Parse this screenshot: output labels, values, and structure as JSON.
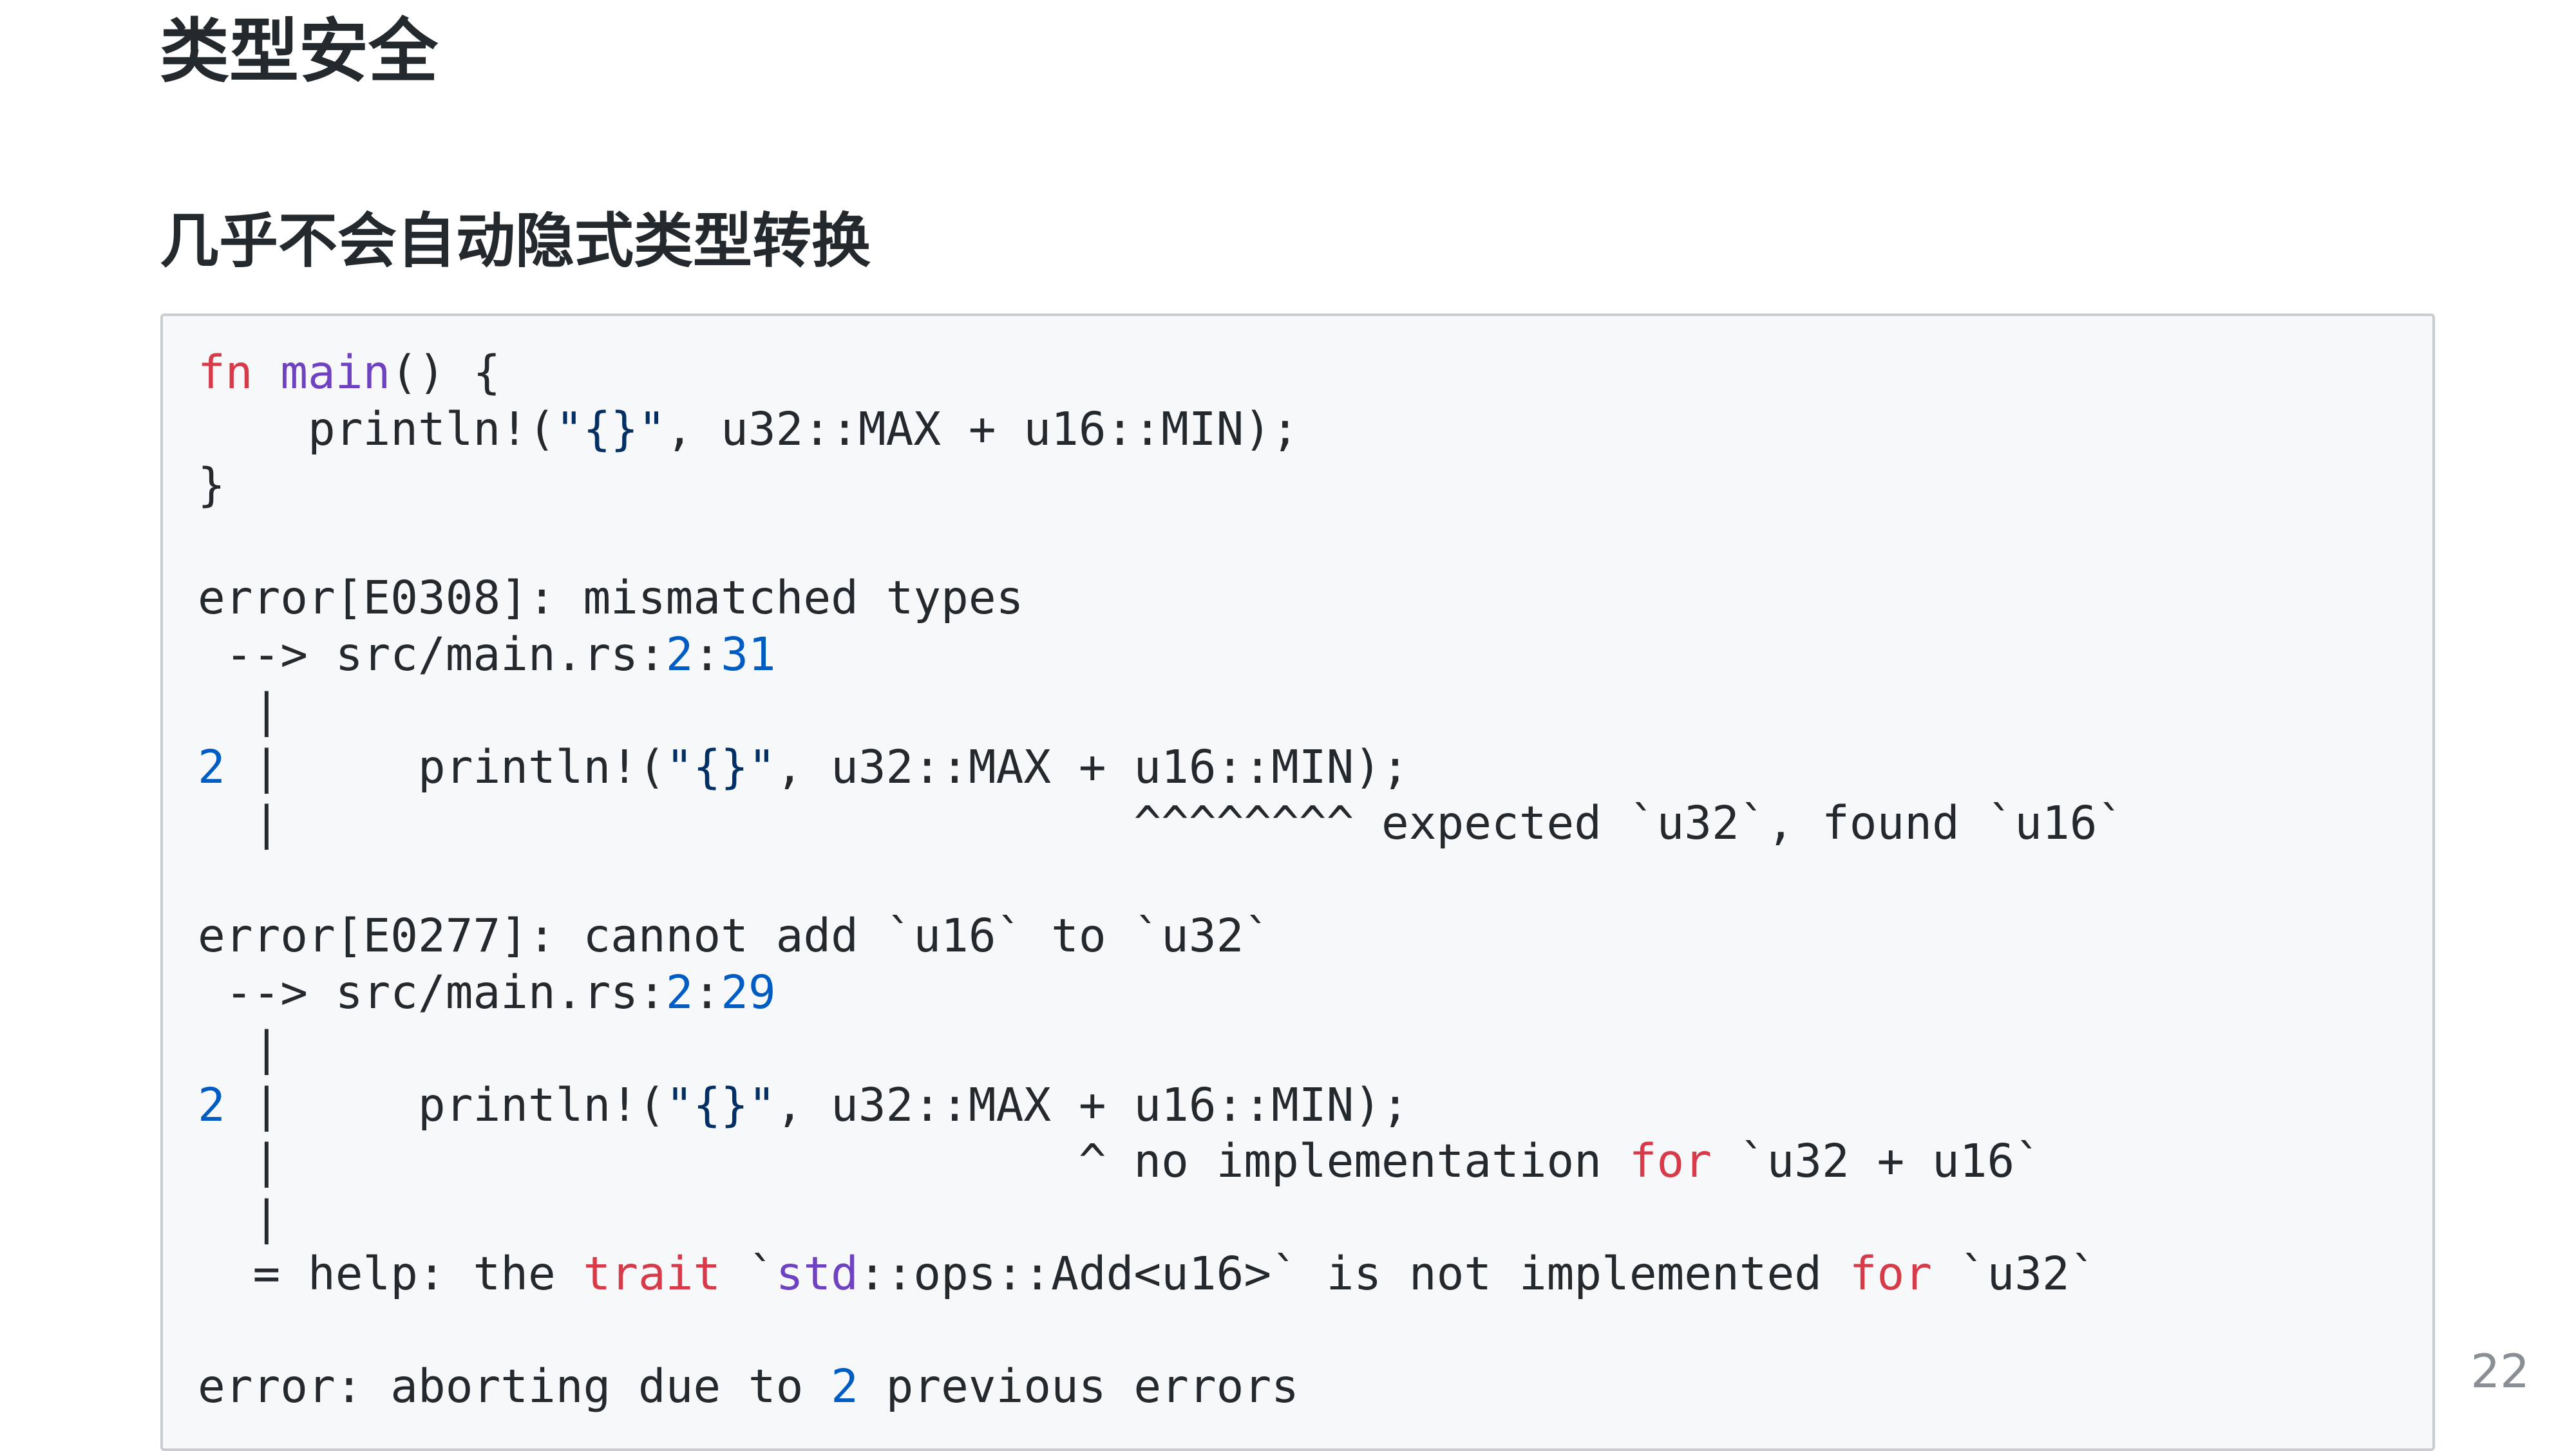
{
  "slide": {
    "title": "类型安全",
    "subtitle": "几乎不会自动隐式类型转换",
    "page_number": "22"
  },
  "code": {
    "lines": [
      [
        {
          "t": "fn",
          "c": "kw"
        },
        {
          "t": " "
        },
        {
          "t": "main",
          "c": "fn"
        },
        {
          "t": "() {"
        }
      ],
      [
        {
          "t": "    println!("
        },
        {
          "t": "\"{}\"",
          "c": "str"
        },
        {
          "t": ", u32::MAX + u16::MIN);"
        }
      ],
      [
        {
          "t": "}"
        }
      ],
      [],
      [
        {
          "t": "error[E0308]: mismatched types"
        }
      ],
      [
        {
          "t": " --> src/main.rs:"
        },
        {
          "t": "2",
          "c": "num"
        },
        {
          "t": ":"
        },
        {
          "t": "31",
          "c": "num"
        }
      ],
      [
        {
          "t": "  |"
        }
      ],
      [
        {
          "t": "2",
          "c": "num"
        },
        {
          "t": " |     println!("
        },
        {
          "t": "\"{}\"",
          "c": "str"
        },
        {
          "t": ", u32::MAX + u16::MIN);"
        }
      ],
      [
        {
          "t": "  |                               ^^^^^^^^ expected `u32`, found `u16`"
        }
      ],
      [],
      [
        {
          "t": "error[E0277]: cannot add `u16` to `u32`"
        }
      ],
      [
        {
          "t": " --> src/main.rs:"
        },
        {
          "t": "2",
          "c": "num"
        },
        {
          "t": ":"
        },
        {
          "t": "29",
          "c": "num"
        }
      ],
      [
        {
          "t": "  |"
        }
      ],
      [
        {
          "t": "2",
          "c": "num"
        },
        {
          "t": " |     println!("
        },
        {
          "t": "\"{}\"",
          "c": "str"
        },
        {
          "t": ", u32::MAX + u16::MIN);"
        }
      ],
      [
        {
          "t": "  |                             ^ no implementation "
        },
        {
          "t": "for",
          "c": "kw"
        },
        {
          "t": " `u32 + u16`"
        }
      ],
      [
        {
          "t": "  |"
        }
      ],
      [
        {
          "t": "  = help: the "
        },
        {
          "t": "trait",
          "c": "kw"
        },
        {
          "t": " `"
        },
        {
          "t": "std",
          "c": "fn"
        },
        {
          "t": "::ops::Add<u16>` is not implemented "
        },
        {
          "t": "for",
          "c": "kw"
        },
        {
          "t": " `u32`"
        }
      ],
      [],
      [
        {
          "t": "error: aborting due to "
        },
        {
          "t": "2",
          "c": "num"
        },
        {
          "t": " previous errors"
        }
      ]
    ]
  },
  "colors": {
    "keyword": "#d73a49",
    "function": "#6f42c1",
    "string": "#032f62",
    "number": "#005cc5",
    "code_background": "#f6f8fa"
  }
}
